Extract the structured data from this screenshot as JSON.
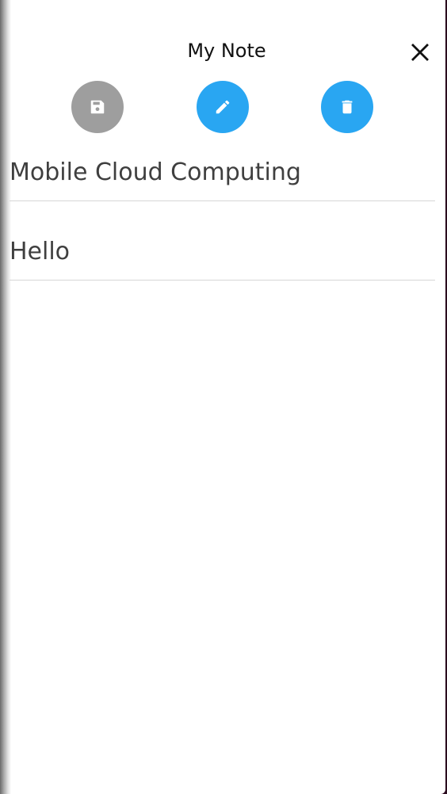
{
  "header": {
    "title": "My Note",
    "close_icon": "close-icon"
  },
  "actions": [
    {
      "name": "save",
      "icon": "save-icon",
      "color": "#9e9e9e"
    },
    {
      "name": "edit",
      "icon": "pencil-icon",
      "color": "#29a6f2"
    },
    {
      "name": "delete",
      "icon": "trash-icon",
      "color": "#29a6f2"
    }
  ],
  "note": {
    "title_value": "Mobile Cloud Computing",
    "body_value": "Hello"
  }
}
